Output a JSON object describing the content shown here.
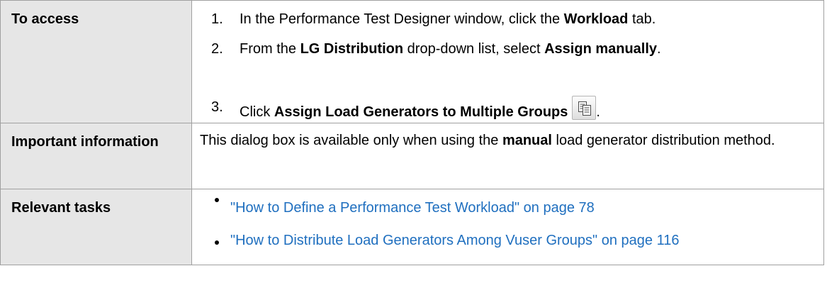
{
  "rows": {
    "access": {
      "header": "To access",
      "steps": [
        {
          "num": "1.",
          "pre": "In the Performance Test Designer window, click the ",
          "bold": "Workload",
          "post": " tab."
        },
        {
          "num": "2.",
          "pre": "From the ",
          "bold1": "LG Distribution",
          "mid": " drop-down list, select ",
          "bold2": "Assign manually",
          "post": "."
        },
        {
          "num": "3.",
          "pre": "Click ",
          "bold": "Assign Load Generators to Multiple Groups",
          "post": "."
        }
      ],
      "icon": "assign-load-generators-icon"
    },
    "important": {
      "header": "Important information",
      "pre": "This dialog box is available only when using the ",
      "bold": "manual",
      "post": " load generator distribution method."
    },
    "tasks": {
      "header": "Relevant tasks",
      "links": [
        "\"How to Define a Performance Test Workload\" on page 78",
        "\"How to Distribute Load Generators Among Vuser Groups\" on page 116"
      ]
    }
  },
  "colors": {
    "header_bg": "#e6e6e6",
    "border": "#a0a0a0",
    "link": "#1f6fbf"
  }
}
